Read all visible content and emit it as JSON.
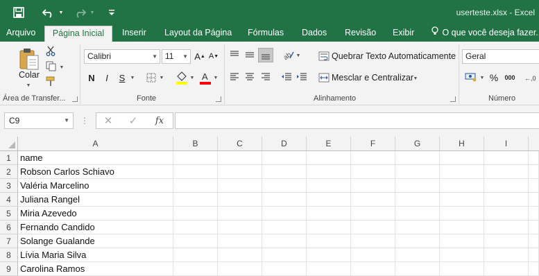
{
  "window": {
    "title": "userteste.xlsx - Excel",
    "accent_color": "#217346"
  },
  "quick_access": {
    "save_icon": "save-icon",
    "undo_icon": "undo-icon",
    "redo_icon": "redo-icon",
    "customize_icon": "customize-qat-icon"
  },
  "tabs": [
    {
      "label": "Arquivo"
    },
    {
      "label": "Página Inicial",
      "active": true
    },
    {
      "label": "Inserir"
    },
    {
      "label": "Layout da Página"
    },
    {
      "label": "Fórmulas"
    },
    {
      "label": "Dados"
    },
    {
      "label": "Revisão"
    },
    {
      "label": "Exibir"
    }
  ],
  "tell_me": "O que você deseja fazer...",
  "ribbon": {
    "clipboard": {
      "paste_label": "Colar",
      "group_label": "Área de Transfer..."
    },
    "font": {
      "font_name": "Calibri",
      "font_size": "11",
      "bold": "N",
      "italic": "I",
      "underline": "S",
      "group_label": "Fonte"
    },
    "alignment": {
      "wrap_text": "Quebrar Texto Automaticamente",
      "merge_center": "Mesclar e Centralizar",
      "group_label": "Alinhamento"
    },
    "number": {
      "format": "Geral",
      "percent": "%",
      "thousands": "000",
      "group_label": "Número"
    }
  },
  "formula_bar": {
    "name_box": "C9",
    "fx": "fx",
    "formula": ""
  },
  "grid": {
    "columns": [
      "A",
      "B",
      "C",
      "D",
      "E",
      "F",
      "G",
      "H",
      "I"
    ],
    "rows": [
      {
        "num": "1",
        "a": "name"
      },
      {
        "num": "2",
        "a": "Robson  Carlos Schiavo"
      },
      {
        "num": "3",
        "a": "Valéria Marcelino"
      },
      {
        "num": "4",
        "a": "Juliana Rangel"
      },
      {
        "num": "5",
        "a": "Miria Azevedo"
      },
      {
        "num": "6",
        "a": "Fernando Candido"
      },
      {
        "num": "7",
        "a": "Solange Gualande"
      },
      {
        "num": "8",
        "a": "Lívia Maria Silva"
      },
      {
        "num": "9",
        "a": "Carolina Ramos"
      }
    ]
  }
}
